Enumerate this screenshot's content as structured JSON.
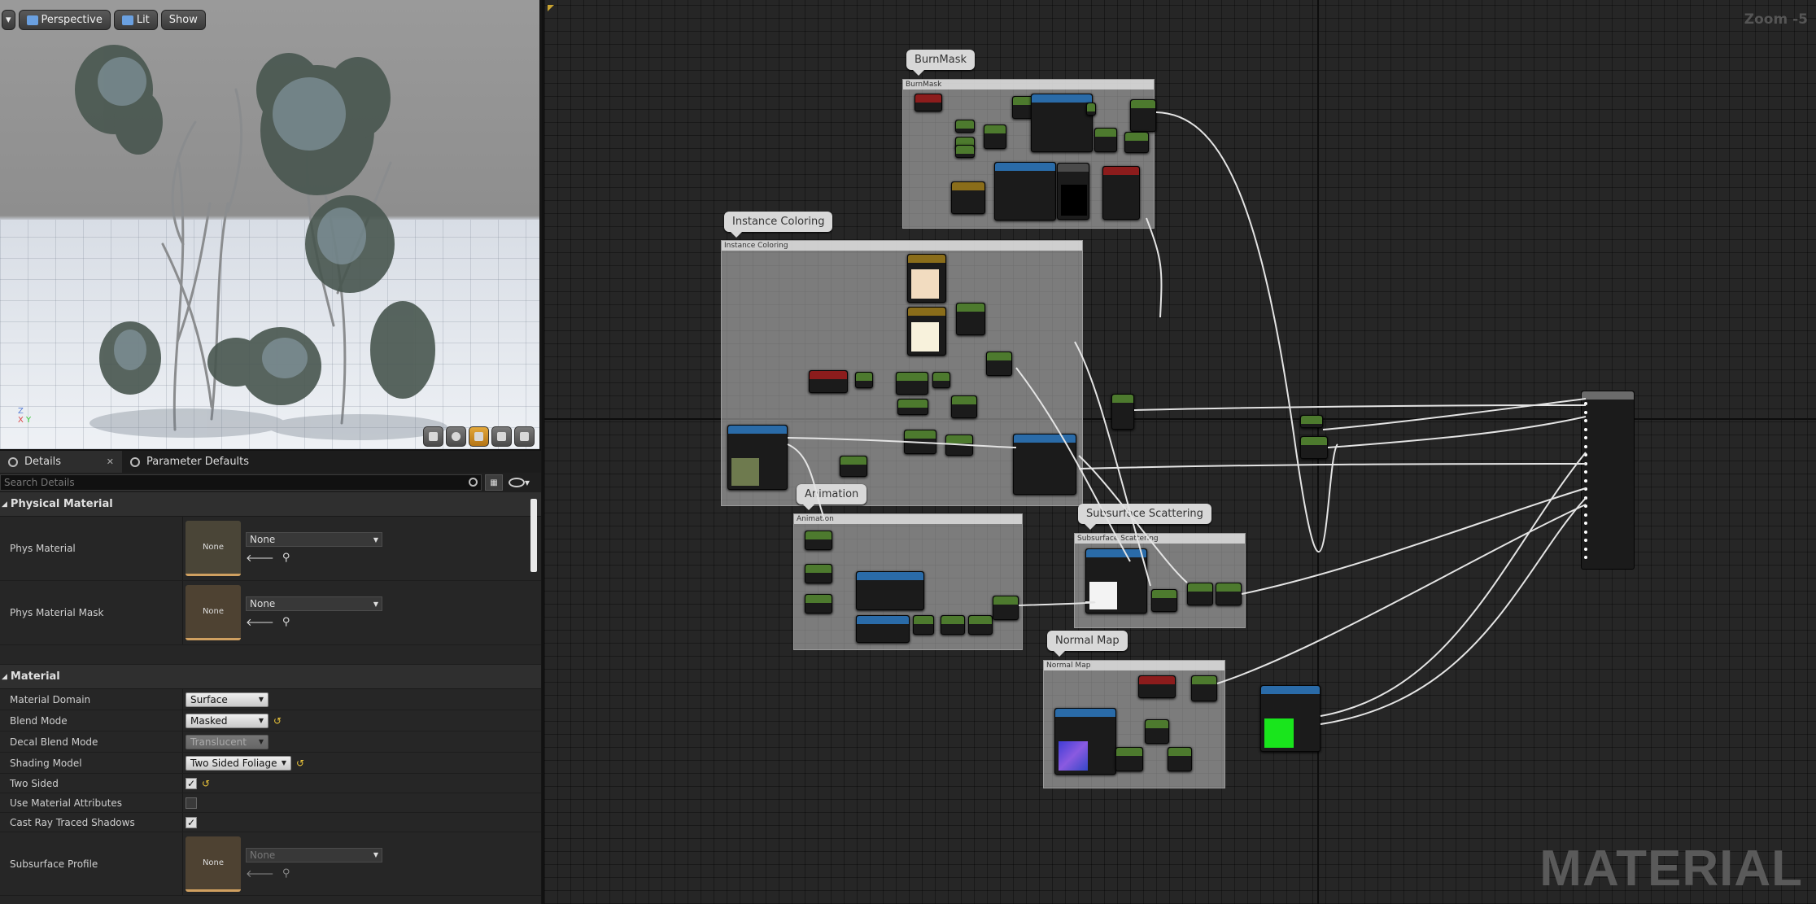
{
  "viewport": {
    "toolbar": {
      "perspective_label": "Perspective",
      "lit_label": "Lit",
      "show_label": "Show"
    },
    "axis": {
      "z": "Z",
      "x": "X",
      "y": "Y"
    }
  },
  "details": {
    "tabs": [
      {
        "label": "Details"
      },
      {
        "label": "Parameter Defaults"
      }
    ],
    "search_placeholder": "Search Details",
    "categories": {
      "physical_material": "Physical Material",
      "material": "Material"
    },
    "physical": {
      "phys_material": {
        "label": "Phys Material",
        "thumb": "None",
        "value": "None"
      },
      "phys_material_mask": {
        "label": "Phys Material Mask",
        "thumb": "None",
        "value": "None"
      }
    },
    "material": {
      "material_domain": {
        "label": "Material Domain",
        "value": "Surface"
      },
      "blend_mode": {
        "label": "Blend Mode",
        "value": "Masked"
      },
      "decal_blend_mode": {
        "label": "Decal Blend Mode",
        "value": "Translucent"
      },
      "shading_model": {
        "label": "Shading Model",
        "value": "Two Sided Foliage"
      },
      "two_sided": {
        "label": "Two Sided",
        "checked": true
      },
      "use_material_attributes": {
        "label": "Use Material Attributes",
        "checked": false
      },
      "cast_ray_traced_shadows": {
        "label": "Cast Ray Traced Shadows",
        "checked": true
      },
      "subsurface_profile": {
        "label": "Subsurface Profile",
        "thumb": "None",
        "value": "None"
      }
    }
  },
  "graph": {
    "zoom": "Zoom -5",
    "watermark": "MATERIAL",
    "comment_groups": [
      {
        "bubble": "BurnMask",
        "title": "BurnMask"
      },
      {
        "bubble": "Instance Coloring",
        "title": "Instance Coloring"
      },
      {
        "bubble": "Animation",
        "title": "Animation"
      },
      {
        "bubble": "Subsurface Scattering",
        "title": "Subsurface Scattering"
      },
      {
        "bubble": "Normal Map",
        "title": "Normal Map"
      }
    ]
  }
}
